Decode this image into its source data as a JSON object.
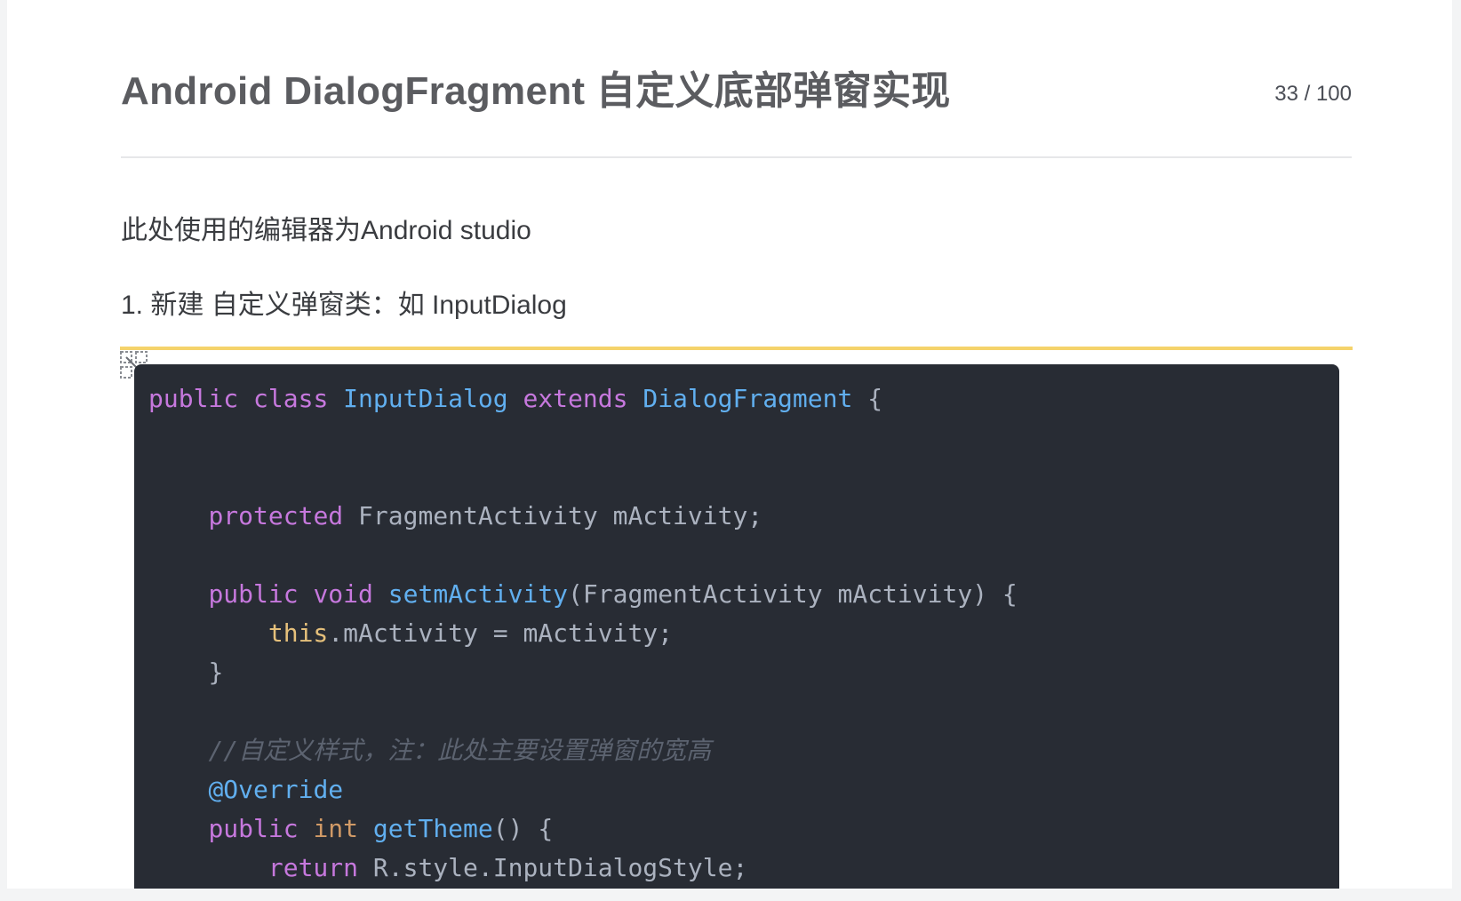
{
  "header": {
    "title": "Android DialogFragment 自定义底部弹窗实现",
    "counter": "33 / 100"
  },
  "content": {
    "paragraph_1": "此处使用的编辑器为Android studio",
    "paragraph_2": "1. 新建 自定义弹窗类：如 InputDialog"
  },
  "icons": {
    "expand": "expand-icon"
  },
  "code": {
    "language": "java",
    "line1": {
      "kw1": "public",
      "kw2": "class",
      "type1": "InputDialog",
      "kw3": "extends",
      "type2": "DialogFragment",
      "rest": " {"
    },
    "line4": {
      "kw": "protected",
      "rest": " FragmentActivity mActivity;"
    },
    "line6": {
      "kw1": "public",
      "kw2": "void",
      "fn": "setmActivity",
      "rest": "(FragmentActivity mActivity) {"
    },
    "line7": {
      "this": "this",
      "rest": ".mActivity = mActivity;"
    },
    "line8": {
      "rest": "}"
    },
    "line10": {
      "comment": "//自定义样式，注：此处主要设置弹窗的宽高"
    },
    "line11": {
      "annotation": "@Override"
    },
    "line12": {
      "kw": "public",
      "prim": "int",
      "fn": "getTheme",
      "rest": "() {"
    },
    "line13": {
      "kw": "return",
      "rest": " R.style.InputDialogStyle;"
    }
  },
  "colors": {
    "code_background": "#282c34",
    "keyword": "#c678dd",
    "type": "#61afef",
    "this": "#e5c07b",
    "primitive": "#d19a66",
    "comment": "#5c6370",
    "accent_line": "#f5d36b"
  }
}
